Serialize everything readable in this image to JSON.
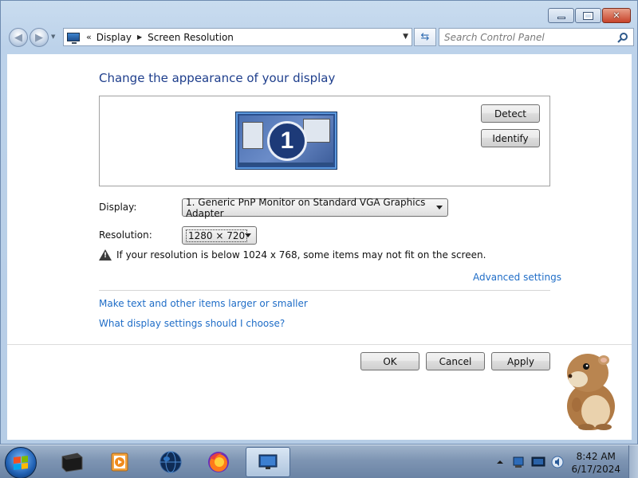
{
  "window": {
    "breadcrumb": {
      "sep": "«",
      "items": [
        "Display",
        "Screen Resolution"
      ]
    },
    "search_placeholder": "Search Control Panel"
  },
  "page": {
    "title": "Change the appearance of your display",
    "monitor_number": "1",
    "detect_label": "Detect",
    "identify_label": "Identify",
    "display_label": "Display:",
    "display_value": "1. Generic PnP Monitor on Standard VGA Graphics Adapter",
    "resolution_label": "Resolution:",
    "resolution_value": "1280 × 720",
    "warning_text": "If your resolution is below 1024 x 768, some items may not fit on the screen.",
    "advanced_link": "Advanced settings",
    "link_text_size": "Make text and other items larger or smaller",
    "link_choose": "What display settings should I choose?",
    "ok_label": "OK",
    "cancel_label": "Cancel",
    "apply_label": "Apply"
  },
  "taskbar": {
    "items": [
      "terminal-icon",
      "media-player-icon",
      "globe-icon",
      "firefox-icon",
      "display-settings-icon"
    ],
    "tray_icons": [
      "show-hidden-icon",
      "network-icon",
      "monitor-icon",
      "volume-icon"
    ],
    "time": "8:42 AM",
    "date": "6/17/2024"
  },
  "colors": {
    "title_blue": "#1e3e8c",
    "link_blue": "#1f6dc7"
  }
}
